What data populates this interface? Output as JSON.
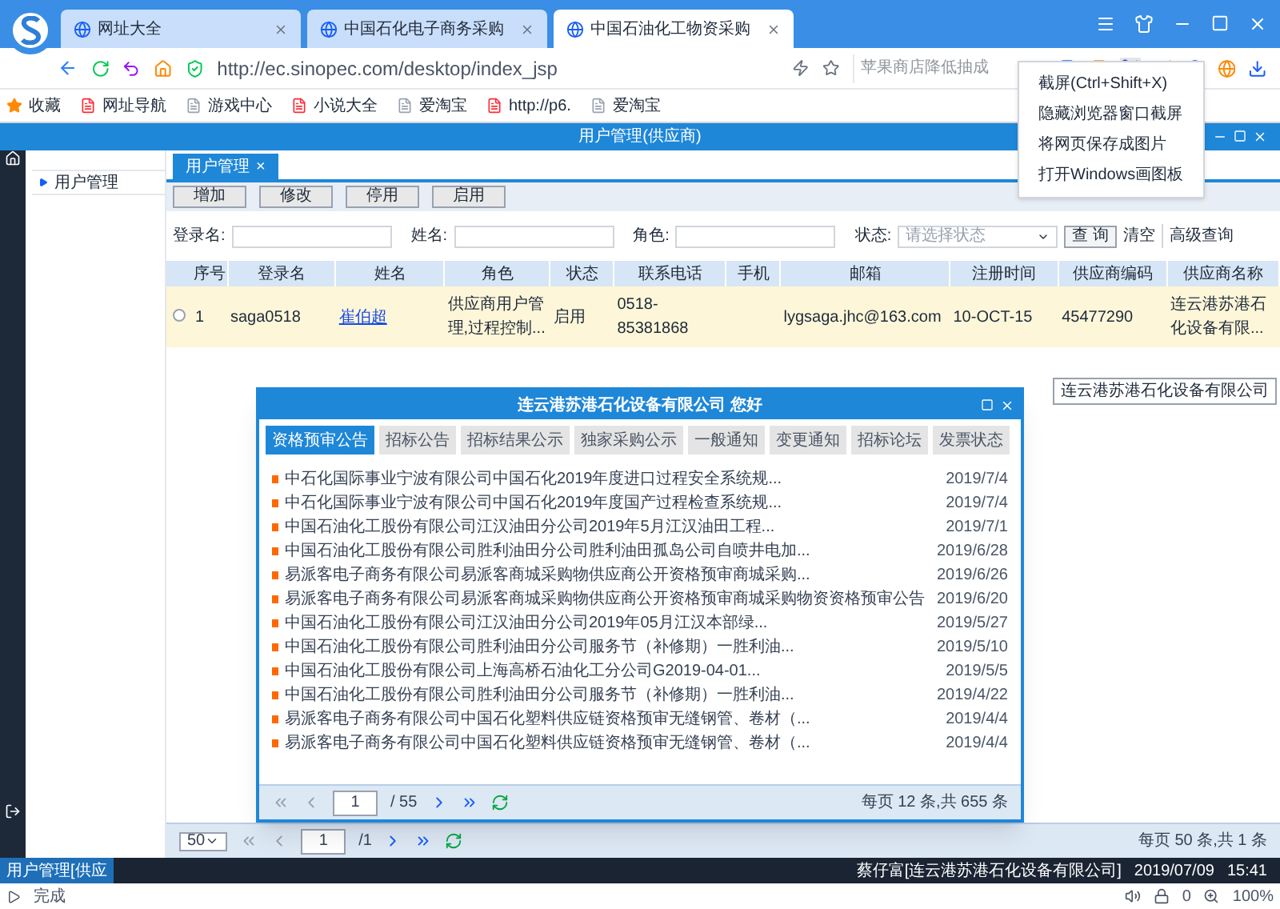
{
  "browser": {
    "tabs": [
      {
        "label": "网址大全",
        "selected": false
      },
      {
        "label": "中国石化电子商务采购",
        "selected": false
      },
      {
        "label": "中国石油化工物资采购",
        "selected": true
      }
    ],
    "url": "http://ec.sinopec.com/desktop/index_jsp",
    "search": {
      "placeholder": "苹果商店降低抽成"
    },
    "bookmarks": [
      "收藏",
      "网址导航",
      "游戏中心",
      "小说大全",
      "爱淘宝",
      "http://p6.",
      "爱淘宝"
    ],
    "screenshot_menu": [
      "截屏(Ctrl+Shift+X)",
      "隐藏浏览器窗口截屏",
      "将网页保存成图片",
      "打开Windows画图板"
    ],
    "status": "完成",
    "blocked_count": "0",
    "zoom": "100%"
  },
  "app": {
    "title": "用户管理(供应商)",
    "sidebar": {
      "items": [
        {
          "label": "用户管理"
        }
      ]
    },
    "page_tab": {
      "label": "用户管理",
      "close": "×"
    },
    "toolbar": [
      "增加",
      "修改",
      "停用",
      "启用"
    ],
    "filters": {
      "login_label": "登录名:",
      "name_label": "姓名:",
      "role_label": "角色:",
      "status_label": "状态:",
      "status_placeholder": "请选择状态",
      "search_button": "查 询",
      "clear": "清空",
      "advanced": "高级查询"
    },
    "table": {
      "columns": [
        "序号",
        "登录名",
        "姓名",
        "角色",
        "状态",
        "联系电话",
        "手机",
        "邮箱",
        "注册时间",
        "供应商编码",
        "供应商名称"
      ],
      "rows": [
        {
          "checked": false,
          "cells": [
            "1",
            "saga0518",
            "崔伯超",
            "供应商用户管理,过程控制...",
            "启用",
            "0518-85381868",
            "",
            "lygsaga.jhc@163.com",
            "10-OCT-15",
            "45477290",
            "连云港苏港石化设备有限..."
          ]
        }
      ]
    },
    "tooltip": "连云港苏港石化设备有限公司",
    "pager": {
      "page_size": "50",
      "page": "1",
      "total_pages": "/1",
      "summary": "每页 50 条,共 1 条"
    },
    "taskbar": {
      "tab": "用户管理[供应",
      "user": "蔡仔富[连云港苏港石化设备有限公司]",
      "date": "2019/07/09",
      "time": "15:41"
    }
  },
  "dialog": {
    "title": "连云港苏港石化设备有限公司 您好",
    "tabs": [
      {
        "label": "资格预审公告",
        "selected": true
      },
      {
        "label": "招标公告",
        "selected": false
      },
      {
        "label": "招标结果公示",
        "selected": false
      },
      {
        "label": "独家采购公示",
        "selected": false
      },
      {
        "label": "一般通知",
        "selected": false
      },
      {
        "label": "变更通知",
        "selected": false
      },
      {
        "label": "招标论坛",
        "selected": false
      },
      {
        "label": "发票状态",
        "selected": false
      }
    ],
    "items": [
      {
        "title": "中石化国际事业宁波有限公司中国石化2019年度进口过程安全系统规...",
        "date": "2019/7/4"
      },
      {
        "title": "中石化国际事业宁波有限公司中国石化2019年度国产过程检查系统规...",
        "date": "2019/7/4"
      },
      {
        "title": "中国石油化工股份有限公司江汉油田分公司2019年5月江汉油田工程...",
        "date": "2019/7/1"
      },
      {
        "title": "中国石油化工股份有限公司胜利油田分公司胜利油田孤岛公司自喷井电加...",
        "date": "2019/6/28"
      },
      {
        "title": "易派客电子商务有限公司易派客商城采购物供应商公开资格预审商城采购...",
        "date": "2019/6/26"
      },
      {
        "title": "易派客电子商务有限公司易派客商城采购物供应商公开资格预审商城采购物资资格预审公告",
        "date": "2019/6/20"
      },
      {
        "title": "中国石油化工股份有限公司江汉油田分公司2019年05月江汉本部绿...",
        "date": "2019/5/27"
      },
      {
        "title": "中国石油化工股份有限公司胜利油田分公司服务节（补修期）一胜利油...",
        "date": "2019/5/10"
      },
      {
        "title": "中国石油化工股份有限公司上海高桥石油化工分公司G2019-04-01...",
        "date": "2019/5/5"
      },
      {
        "title": "中国石油化工股份有限公司胜利油田分公司服务节（补修期）一胜利油...",
        "date": "2019/4/22"
      },
      {
        "title": "易派客电子商务有限公司中国石化塑料供应链资格预审无缝钢管、卷材（...",
        "date": "2019/4/4"
      },
      {
        "title": "易派客电子商务有限公司中国石化塑料供应链资格预审无缝钢管、卷材（...",
        "date": "2019/4/4"
      }
    ],
    "pager": {
      "page": "1",
      "total_pages": "/ 55",
      "summary": "每页 12 条,共 655 条"
    }
  }
}
